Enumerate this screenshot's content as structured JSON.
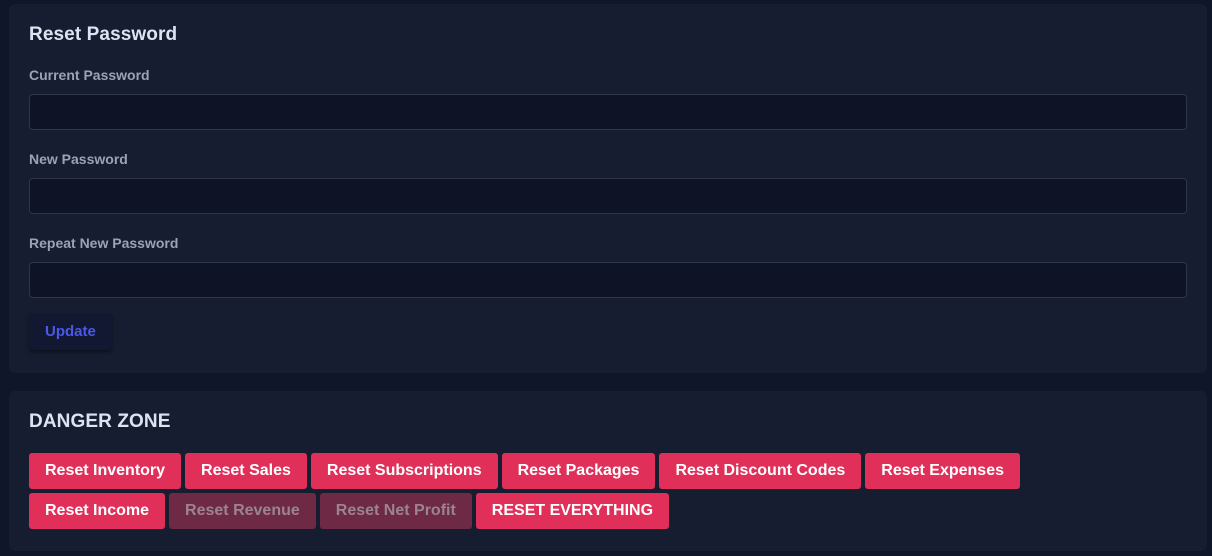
{
  "reset_password": {
    "title": "Reset Password",
    "fields": [
      {
        "label": "Current Password",
        "value": "",
        "placeholder": ""
      },
      {
        "label": "New Password",
        "value": "",
        "placeholder": ""
      },
      {
        "label": "Repeat New Password",
        "value": "",
        "placeholder": ""
      }
    ],
    "update_label": "Update"
  },
  "danger_zone": {
    "title": "DANGER ZONE",
    "row1": [
      {
        "label": "Reset Inventory",
        "disabled": false
      },
      {
        "label": "Reset Sales",
        "disabled": false
      },
      {
        "label": "Reset Subscriptions",
        "disabled": false
      },
      {
        "label": "Reset Packages",
        "disabled": false
      },
      {
        "label": "Reset Discount Codes",
        "disabled": false
      },
      {
        "label": "Reset Expenses",
        "disabled": false
      }
    ],
    "row2": [
      {
        "label": "Reset Income",
        "disabled": false
      },
      {
        "label": "Reset Revenue",
        "disabled": true
      },
      {
        "label": "Reset Net Profit",
        "disabled": true
      },
      {
        "label": "RESET EVERYTHING",
        "disabled": false
      }
    ]
  },
  "colors": {
    "background": "#10162a",
    "card": "#171d31",
    "input_bg": "#0e1326",
    "accent_blue": "#4a58e8",
    "danger": "#e0305a",
    "danger_disabled": "#6e2944"
  }
}
